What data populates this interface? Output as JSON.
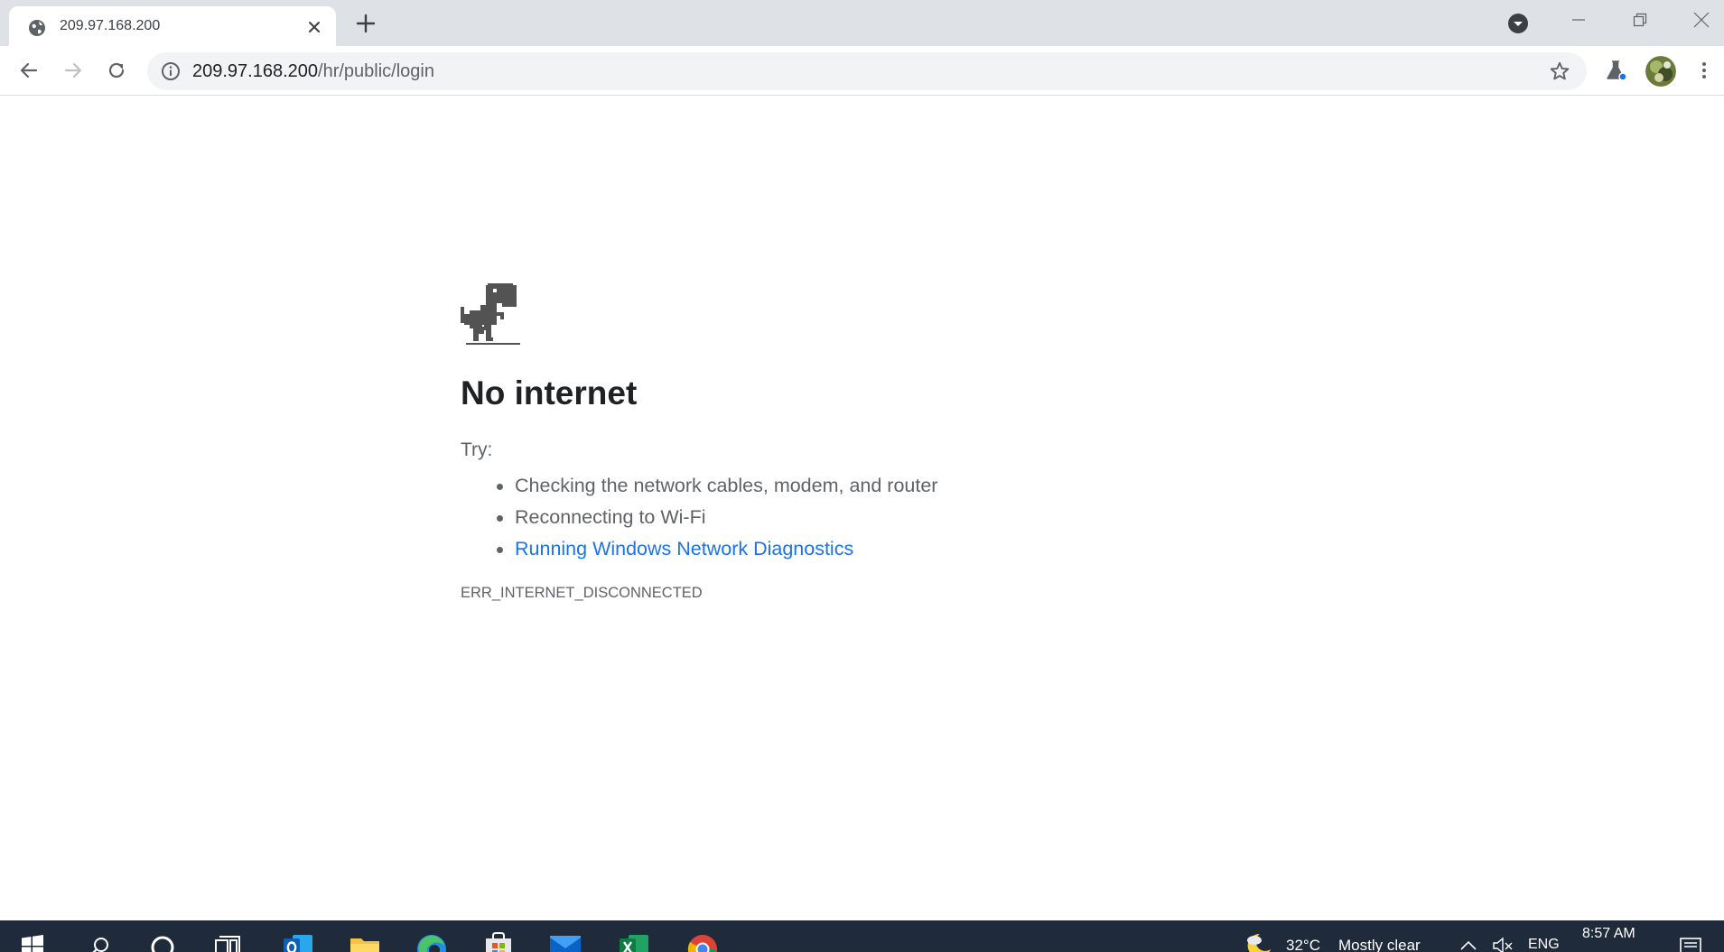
{
  "browser": {
    "tab": {
      "title": "209.97.168.200",
      "favicon": "globe-icon"
    },
    "new_tab_icon": "plus-icon",
    "omnibox": {
      "host": "209.97.168.200",
      "path": "/hr/public/login",
      "security_icon": "info-icon"
    },
    "window_controls": [
      "minimize-icon",
      "restore-icon",
      "close-icon"
    ]
  },
  "page": {
    "title": "No internet",
    "try_label": "Try:",
    "suggestions": [
      "Checking the network cables, modem, and router",
      "Reconnecting to Wi-Fi",
      "Running Windows Network Diagnostics"
    ],
    "error_code": "ERR_INTERNET_DISCONNECTED",
    "link_color": "#1a73e8"
  },
  "taskbar": {
    "weather": {
      "temperature": "32°C",
      "condition": "Mostly clear"
    },
    "language": "ENG",
    "clock": "8:57 AM",
    "apps": [
      "windows-start-icon",
      "search-icon",
      "cortana-icon",
      "task-view-icon",
      "outlook-icon",
      "file-explorer-icon",
      "edge-icon",
      "store-icon",
      "mail-icon",
      "excel-icon",
      "chrome-icon"
    ]
  }
}
